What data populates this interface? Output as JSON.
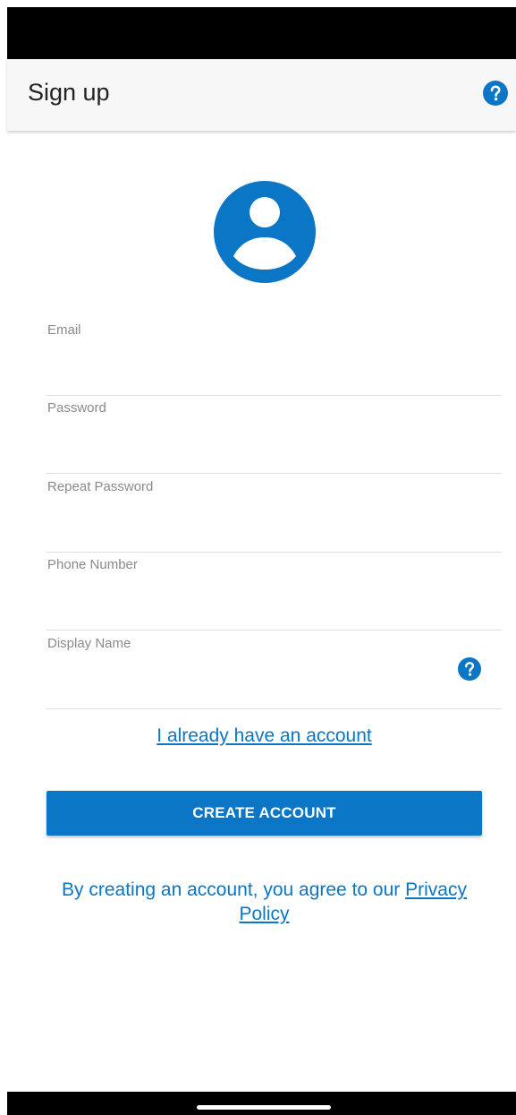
{
  "header": {
    "title": "Sign up",
    "help_icon": "help-circle-icon"
  },
  "colors": {
    "accent": "#0b76c5",
    "app_bar_bg": "#f7f7f7",
    "divider": "#dcdcdc",
    "label_gray": "#8a8a8a"
  },
  "avatar": {
    "icon": "account-circle-icon"
  },
  "form": {
    "email": {
      "label": "Email",
      "value": ""
    },
    "password": {
      "label": "Password",
      "value": ""
    },
    "repeat_password": {
      "label": "Repeat Password",
      "value": ""
    },
    "phone": {
      "label": "Phone Number",
      "value": ""
    },
    "display_name": {
      "label": "Display Name",
      "value": "",
      "help_icon": "help-circle-icon"
    }
  },
  "links": {
    "login": "I already have an account"
  },
  "buttons": {
    "create_account": "CREATE ACCOUNT"
  },
  "legal": {
    "prefix": "By creating an account, you agree to our ",
    "policy_link": "Privacy Policy"
  }
}
